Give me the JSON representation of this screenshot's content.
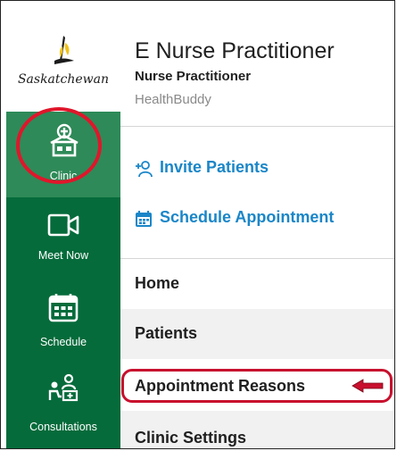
{
  "logo": {
    "text": "Saskatchewan"
  },
  "sidebar": {
    "items": [
      {
        "label": "Clinic",
        "icon": "clinic-icon",
        "active": true
      },
      {
        "label": "Meet Now",
        "icon": "video-camera-icon"
      },
      {
        "label": "Schedule",
        "icon": "calendar-icon"
      },
      {
        "label": "Consultations",
        "icon": "consultation-icon"
      }
    ]
  },
  "header": {
    "title": "E Nurse Practitioner",
    "subtitle": "Nurse Practitioner",
    "organization": "HealthBuddy"
  },
  "actions": {
    "invite": {
      "label": "Invite Patients",
      "icon": "add-person-icon"
    },
    "schedule": {
      "label": "Schedule Appointment",
      "icon": "calendar-icon"
    }
  },
  "menu": {
    "items": [
      {
        "label": "Home"
      },
      {
        "label": "Patients"
      },
      {
        "label": "Appointment Reasons",
        "highlighted": true
      },
      {
        "label": "Clinic Settings"
      }
    ]
  },
  "colors": {
    "sidebar": "#056b3b",
    "sidebar_active": "#2e8a58",
    "action_text": "#1a86c8",
    "highlight": "#c8102e"
  }
}
